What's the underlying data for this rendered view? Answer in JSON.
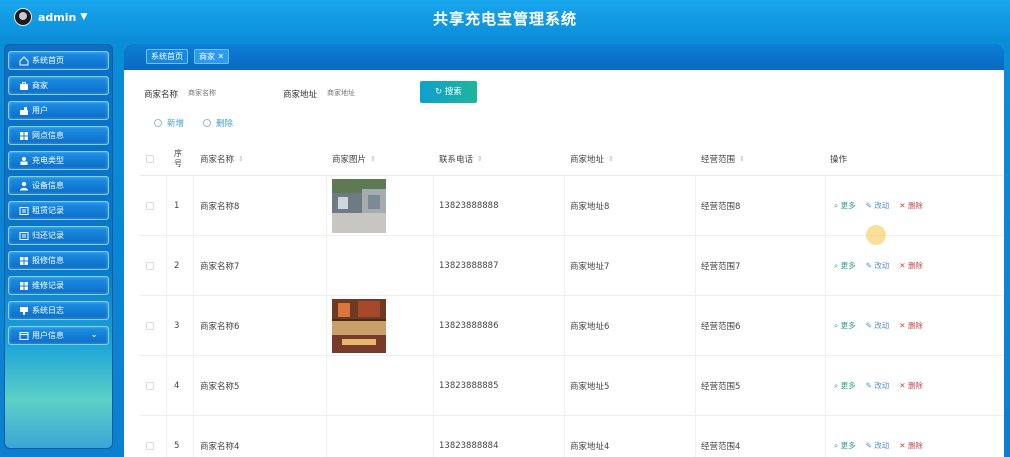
{
  "header": {
    "username": "admin",
    "title": "共享充电宝管理系统"
  },
  "sidebar": {
    "items": [
      {
        "label": "系统首页",
        "icon": "home-icon"
      },
      {
        "label": "商家",
        "icon": "briefcase-icon"
      },
      {
        "label": "用户",
        "icon": "user-card-icon"
      },
      {
        "label": "网点信息",
        "icon": "grid-icon"
      },
      {
        "label": "充电类型",
        "icon": "user-badge-icon"
      },
      {
        "label": "设备信息",
        "icon": "person-icon"
      },
      {
        "label": "租赁记录",
        "icon": "list-icon"
      },
      {
        "label": "归还记录",
        "icon": "list-icon"
      },
      {
        "label": "报修信息",
        "icon": "grid-icon"
      },
      {
        "label": "维修记录",
        "icon": "grid-icon"
      },
      {
        "label": "系统日志",
        "icon": "flag-icon"
      },
      {
        "label": "用户信息",
        "icon": "window-icon"
      }
    ]
  },
  "tabs": [
    {
      "label": "系统首页"
    },
    {
      "label": "商家 ✕"
    }
  ],
  "search": {
    "name_label": "商家名称",
    "name_placeholder": "商家名称",
    "address_label": "商家地址",
    "address_placeholder": "商家地址",
    "button_label": "搜索"
  },
  "actions": {
    "add_label": "新增",
    "delete_label": "删除"
  },
  "table": {
    "columns": [
      "序号",
      "商家名称",
      "商家图片",
      "联系电话",
      "商家地址",
      "经营范围",
      "操作"
    ],
    "rows": [
      {
        "index": "1",
        "name": "商家名称8",
        "phone": "13823888888",
        "address": "商家地址8",
        "scope": "经营范围8",
        "has_photo": true
      },
      {
        "index": "2",
        "name": "商家名称7",
        "phone": "13823888887",
        "address": "商家地址7",
        "scope": "经营范围7",
        "has_photo": false
      },
      {
        "index": "3",
        "name": "商家名称6",
        "phone": "13823888886",
        "address": "商家地址6",
        "scope": "经营范围6",
        "has_photo": true
      },
      {
        "index": "4",
        "name": "商家名称5",
        "phone": "13823888885",
        "address": "商家地址5",
        "scope": "经营范围5",
        "has_photo": false
      },
      {
        "index": "5",
        "name": "商家名称4",
        "phone": "13823888884",
        "address": "商家地址4",
        "scope": "经营范围4",
        "has_photo": false
      }
    ],
    "ops": {
      "more": "更多",
      "edit": "改动",
      "delete": "删除"
    }
  },
  "colors": {
    "header_bg": "#0c8fdb",
    "search_button": "#1fb59a",
    "op_more": "#2f9f8f",
    "op_edit": "#5a8fc9",
    "op_delete": "#c44a4a"
  }
}
